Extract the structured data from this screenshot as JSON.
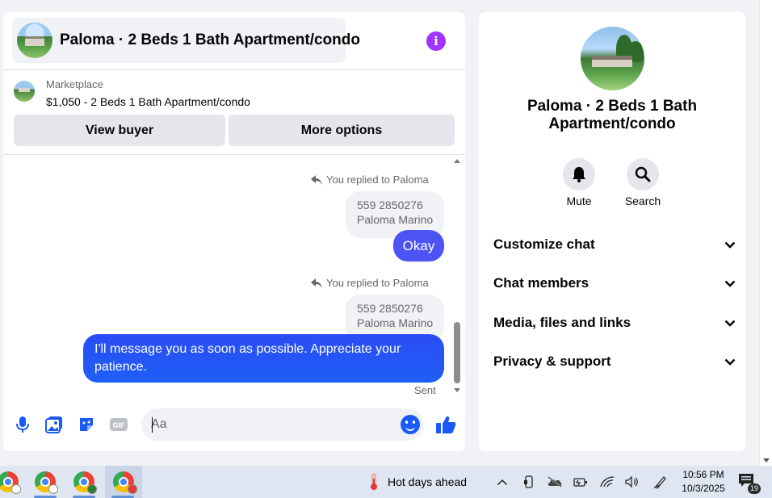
{
  "chat": {
    "title": "Paloma · 2 Beds 1 Bath Apartment/condo",
    "marketplace_label": "Marketplace",
    "listing_price": "$1,050 - 2 Beds 1 Bath Apartment/condo",
    "view_buyer_label": "View buyer",
    "more_options_label": "More options",
    "messages": [
      {
        "replied_label": "You replied to Paloma",
        "quoted_line1": "559 2850276",
        "quoted_line2": "Paloma Marino",
        "text": "Okay"
      },
      {
        "replied_label": "You replied to Paloma",
        "quoted_line1": "559 2850276",
        "quoted_line2": "Paloma Marino",
        "text": "I'll message you as soon as possible. Appreciate your patience."
      }
    ],
    "status": "Sent",
    "composer": {
      "placeholder": "Aa",
      "value": ""
    },
    "colors": {
      "accent_purple": "#a033ff",
      "bubble_blue": "#1a59f5",
      "bubble_indigo": "#4d54f5"
    }
  },
  "side": {
    "title": "Paloma · 2 Beds 1 Bath Apartment/condo",
    "actions": [
      {
        "label": "Mute",
        "icon": "bell-icon"
      },
      {
        "label": "Search",
        "icon": "search-icon"
      }
    ],
    "sections": [
      "Customize chat",
      "Chat members",
      "Media, files and links",
      "Privacy & support"
    ]
  },
  "taskbar": {
    "weather": "Hot days ahead",
    "time": "10:56 PM",
    "date": "10/3/2025",
    "notification_count": "19"
  }
}
